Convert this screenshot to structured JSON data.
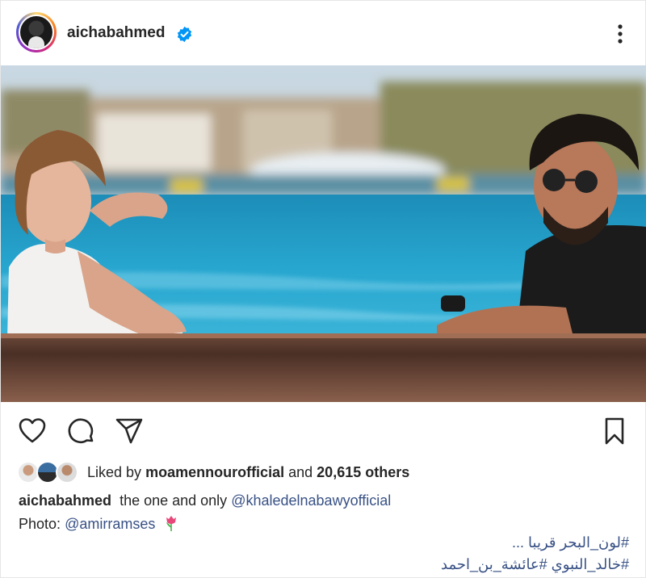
{
  "post": {
    "username": "aichabahmed",
    "verified": true,
    "icons": {
      "verified": "verified-badge-icon",
      "menu": "more-options-icon",
      "like": "heart-icon",
      "comment": "comment-icon",
      "share": "send-icon",
      "save": "bookmark-icon"
    },
    "likes": {
      "prefix": "Liked by",
      "user": "moamennourofficial",
      "middle": "and",
      "count": "20,615 others"
    },
    "caption": {
      "username": "aichabahmed",
      "text": "the one and only",
      "mention": "@khaledelnabawyofficial"
    },
    "photo_credit": {
      "label": "Photo:",
      "mention": "@amirramses",
      "emoji": "tulip"
    },
    "hashtags": [
      "#لون_البحر قريبا ...",
      "#خالد_النبوي #عائشة_بن_احمد"
    ],
    "colors": {
      "text": "#262626",
      "link": "#385185",
      "verified": "#0095f6"
    }
  }
}
